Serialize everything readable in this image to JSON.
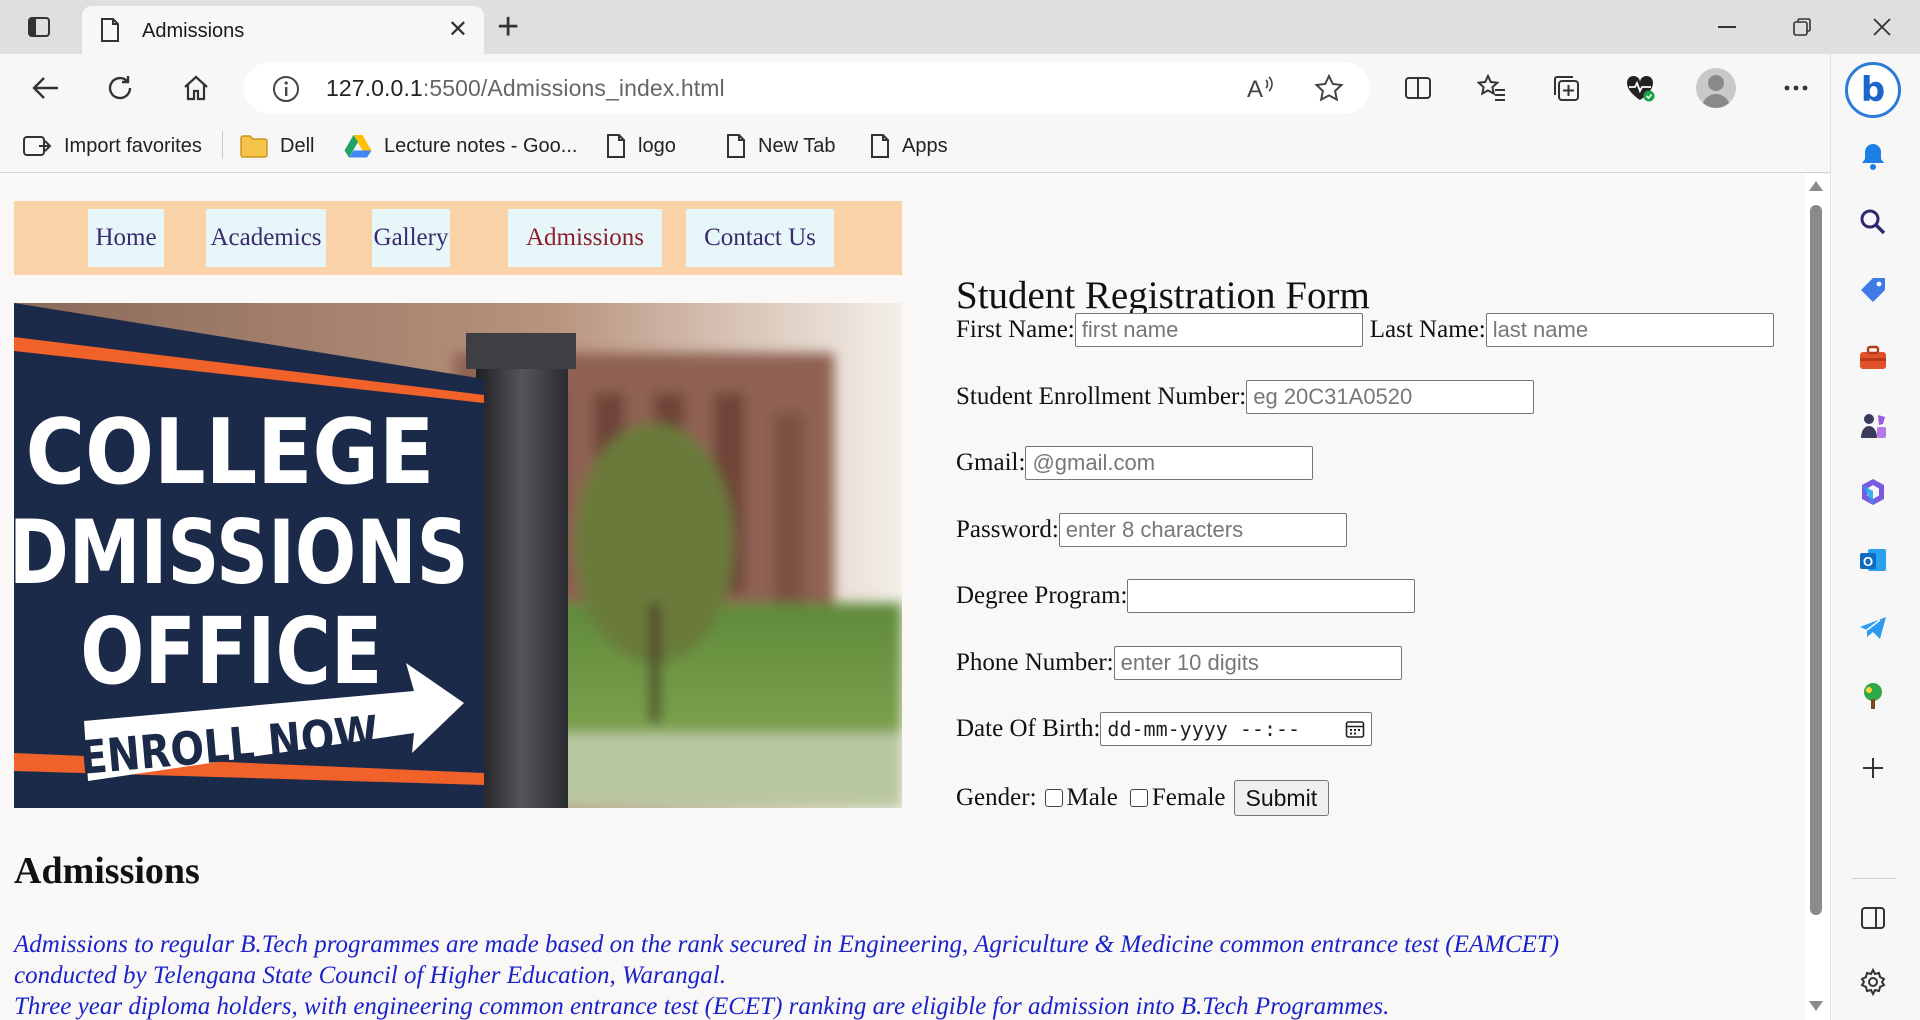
{
  "browser": {
    "tab_title": "Admissions",
    "url_host": "127.0.0.1",
    "url_rest": ":5500/Admissions_index.html",
    "favorites": [
      {
        "label": "Import favorites",
        "icon": "import-icon"
      },
      {
        "label": "Dell",
        "icon": "folder-icon"
      },
      {
        "label": "Lecture notes - Goo...",
        "icon": "google-drive-icon"
      },
      {
        "label": "logo",
        "icon": "page-icon"
      },
      {
        "label": "New Tab",
        "icon": "page-icon"
      },
      {
        "label": "Apps",
        "icon": "page-icon"
      }
    ],
    "bing_label": "b"
  },
  "nav": {
    "items": [
      "Home",
      "Academics",
      "Gallery",
      "Admissions",
      "Contact Us"
    ],
    "active": "Admissions"
  },
  "hero": {
    "sign_line1": "COLLEGE",
    "sign_line2": "ADMISSIONS",
    "sign_line3": "OFFICE",
    "arrow_text": "ENROLL NOW"
  },
  "form": {
    "title": "Student Registration Form",
    "first_name_label": "First Name:",
    "first_name_placeholder": "first name",
    "last_name_label": "Last Name:",
    "last_name_placeholder": "last name",
    "enrollment_label": "Student Enrollment Number:",
    "enrollment_placeholder": "eg 20C31A0520",
    "gmail_label": "Gmail:",
    "gmail_placeholder": "@gmail.com",
    "password_label": "Password:",
    "password_placeholder": "enter 8 characters",
    "degree_label": "Degree Program:",
    "degree_value": "",
    "phone_label": "Phone Number:",
    "phone_placeholder": "enter 10 digits",
    "dob_label": "Date Of Birth:",
    "dob_value": "dd-mm-yyyy --:--",
    "gender_label": "Gender:",
    "gender_male": "Male",
    "gender_female": "Female",
    "submit_label": "Submit"
  },
  "admissions": {
    "heading": "Admissions",
    "text_line1": "Admissions to regular B.Tech programmes are made based on the rank secured in Engineering, Agriculture & Medicine common entrance test (EAMCET)",
    "text_line2": "conducted by Telengana State Council of Higher Education, Warangal.",
    "text_line3": "Three year diploma holders, with engineering common entrance test (ECET) ranking are eligible for admission into B.Tech Programmes."
  },
  "colors": {
    "navbar_bg": "#f9d2a8",
    "nav_link_bg": "#e7f6f8",
    "nav_active": "#8b1e2b",
    "body_text_blue": "#1a23c9"
  }
}
